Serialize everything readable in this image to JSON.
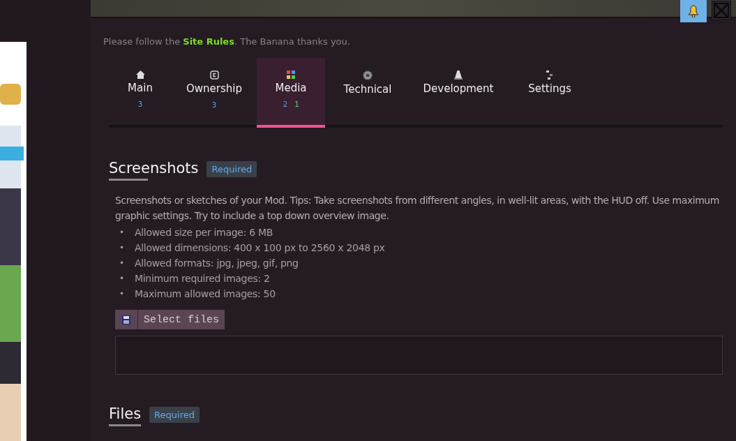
{
  "notice": "Please follow the **Site Rules**. The Banana thanks you.",
  "tabs": [
    {
      "label": "Main",
      "selected": false,
      "counts": [
        {
          "text": "3",
          "color": "#5a9fe0"
        }
      ]
    },
    {
      "label": "Ownership",
      "selected": false,
      "counts": [
        {
          "text": "3",
          "color": "#5a9fe0"
        }
      ]
    },
    {
      "label": "Media",
      "selected": true,
      "counts": [
        {
          "text": "2",
          "color": "#5a9fe0"
        },
        {
          "text": "1",
          "color": "#5fd35f"
        }
      ]
    },
    {
      "label": "Technical",
      "selected": false
    },
    {
      "label": "Development",
      "selected": false
    },
    {
      "label": "Settings",
      "selected": false
    }
  ],
  "sections": [
    {
      "title": "Screenshots",
      "badge": "Required",
      "description": "Screenshots or sketches of your Mod. Tips: Take screenshots from different angles, in well-lit areas, with the HUD off. Use maximum graphic settings. Try to include a top down overview image.",
      "rules": [
        {
          "marker": "•",
          "text": "Allowed size per image: 6 MB"
        },
        {
          "marker": "•",
          "text": "Allowed dimensions: 400 x 100 px to 2560 x 2048 px"
        },
        {
          "marker": "•",
          "text": "Allowed formats: jpg, jpeg, gif, png"
        },
        {
          "marker": "•",
          "text": "Minimum required images: 2"
        },
        {
          "marker": "•",
          "text": "Maximum allowed images: 50"
        }
      ],
      "button": "Select files"
    },
    {
      "title": "Files",
      "badge": "Required"
    }
  ]
}
